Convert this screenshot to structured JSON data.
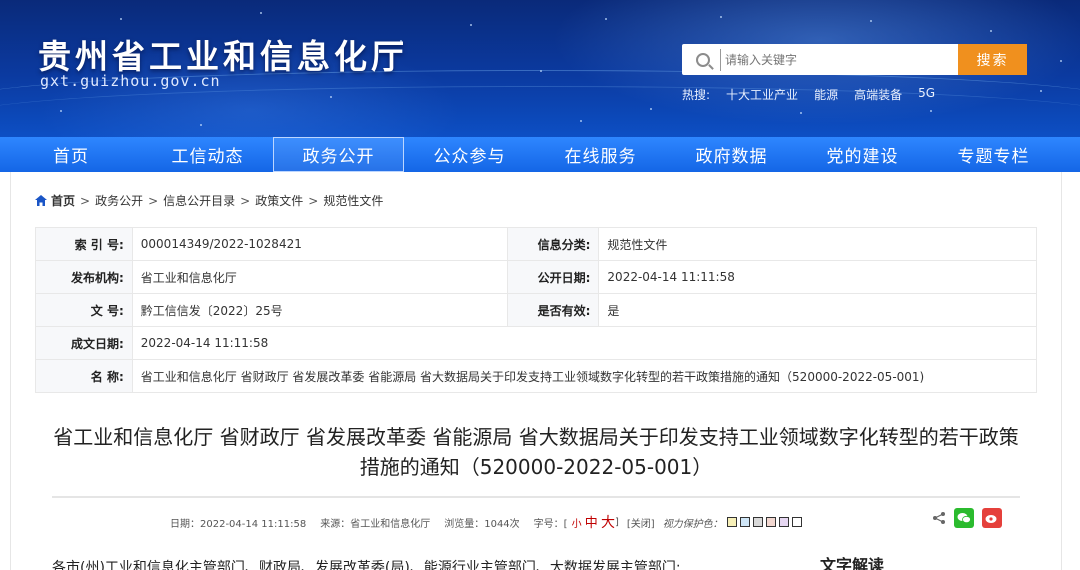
{
  "header": {
    "site_title": "贵州省工业和信息化厅",
    "domain": "gxt.guizhou.gov.cn",
    "search_placeholder": "请输入关键字",
    "search_button": "搜索",
    "hot_label": "热搜:",
    "hot_words": [
      "十大工业产业",
      "能源",
      "高端装备",
      "5G"
    ]
  },
  "nav": {
    "items": [
      "首页",
      "工信动态",
      "政务公开",
      "公众参与",
      "在线服务",
      "政府数据",
      "党的建设",
      "专题专栏"
    ],
    "active": "政务公开"
  },
  "breadcrumb": {
    "home": "首页",
    "path": [
      "政务公开",
      "信息公开目录",
      "政策文件",
      "规范性文件"
    ]
  },
  "meta": {
    "index_label": "索 引 号:",
    "index_value": "000014349/2022-1028421",
    "category_label": "信息分类:",
    "category_value": "规范性文件",
    "publisher_label": "发布机构:",
    "publisher_value": "省工业和信息化厅",
    "pub_date_label": "公开日期:",
    "pub_date_value": "2022-04-14 11:11:58",
    "doc_no_label": "文 号:",
    "doc_no_value": "黔工信信发〔2022〕25号",
    "valid_label": "是否有效:",
    "valid_value": "是",
    "created_label": "成文日期:",
    "created_value": "2022-04-14 11:11:58",
    "name_label": "名 称:",
    "name_value": "省工业和信息化厅 省财政厅 省发展改革委 省能源局 省大数据局关于印发支持工业领域数字化转型的若干政策措施的通知（520000-2022-05-001)"
  },
  "article": {
    "title": "省工业和信息化厅 省财政厅 省发展改革委 省能源局 省大数据局关于印发支持工业领域数字化转型的若干政策措施的通知（520000-2022-05-001）",
    "date_label": "日期：2022-04-14 11:11:58",
    "source_label": "来源：省工业和信息化厅",
    "views_label": "浏览量：1044次",
    "fontsize_label": "字号：[",
    "fs_small": "小",
    "fs_mid": "中",
    "fs_big": "大",
    "fs_close": "]",
    "close_label": "[关闭]",
    "eye_label": "视力保护色：",
    "eye_colors": [
      "#f7f0b8",
      "#cfe6f7",
      "#d9d9d9",
      "#f2d7d0",
      "#e6d7f2",
      "#ffffff"
    ],
    "first_line": "各市(州)工业和信息化主管部门、财政局、发展改革委(局)、能源行业主管部门、大数据发展主管部门:",
    "side_heading": "文字解读"
  },
  "colors": {
    "nav_bg": "#1f76f2",
    "search_button": "#f0901e",
    "accent_red": "#c00000"
  }
}
